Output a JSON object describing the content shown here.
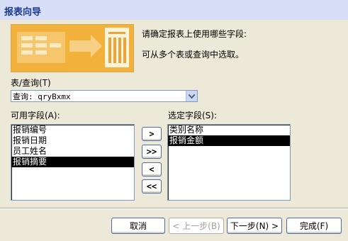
{
  "window": {
    "title": "报表向导"
  },
  "prompts": {
    "line1": "请确定报表上使用哪些字段:",
    "line2": "可从多个表或查询中选取。"
  },
  "table_query": {
    "label": "表/查询(T)",
    "value": "查询: qryBxmx"
  },
  "available": {
    "label": "可用字段(A):",
    "items": [
      "报销编号",
      "报销日期",
      "员工姓名",
      "报销摘要"
    ],
    "selected_index": 3
  },
  "selected": {
    "label": "选定字段(S):",
    "items": [
      "类别名称",
      "报销金额"
    ],
    "selected_index": 1
  },
  "move_buttons": {
    "add_one": ">",
    "add_all": ">>",
    "remove_one": "<",
    "remove_all": "<<"
  },
  "footer": {
    "cancel": "取消",
    "back": "< 上一步(B)",
    "next": "下一步(N) >",
    "finish": "完成(F)"
  },
  "icons": {
    "dropdown": "chevron-down-icon",
    "wizard": "report-wizard-illustration"
  },
  "colors": {
    "selection": "#000000",
    "titlebar": "#d6dff7",
    "dialog": "#ece9d8"
  }
}
